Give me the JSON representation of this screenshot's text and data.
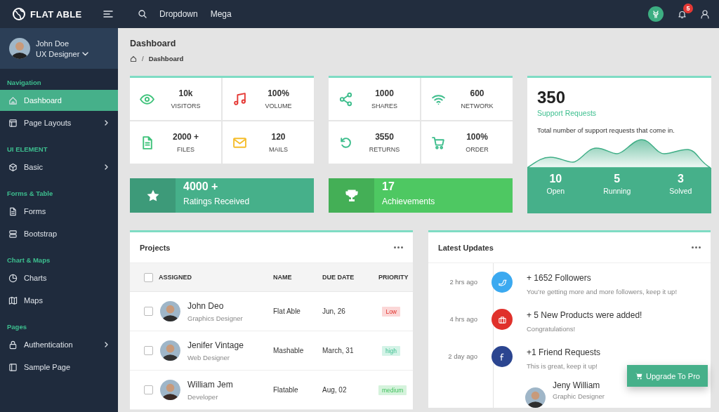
{
  "topbar": {
    "brand": "FLAT ABLE",
    "links": [
      "Dropdown",
      "Mega"
    ],
    "notification_count": "5"
  },
  "sidebar": {
    "user": {
      "name": "John Doe",
      "role": "UX Designer"
    },
    "sections": [
      {
        "title": "Navigation",
        "items": [
          {
            "label": "Dashboard",
            "selected": true,
            "expandable": false
          },
          {
            "label": "Page Layouts",
            "selected": false,
            "expandable": true
          }
        ]
      },
      {
        "title": "UI ELEMENT",
        "items": [
          {
            "label": "Basic",
            "selected": false,
            "expandable": true
          }
        ]
      },
      {
        "title": "Forms & Table",
        "items": [
          {
            "label": "Forms",
            "selected": false,
            "expandable": false
          },
          {
            "label": "Bootstrap",
            "selected": false,
            "expandable": false
          }
        ]
      },
      {
        "title": "Chart & Maps",
        "items": [
          {
            "label": "Charts",
            "selected": false,
            "expandable": false
          },
          {
            "label": "Maps",
            "selected": false,
            "expandable": false
          }
        ]
      },
      {
        "title": "Pages",
        "items": [
          {
            "label": "Authentication",
            "selected": false,
            "expandable": true
          },
          {
            "label": "Sample Page",
            "selected": false,
            "expandable": false
          }
        ]
      }
    ]
  },
  "page": {
    "title": "Dashboard",
    "breadcrumb_separator": "/",
    "breadcrumb": "Dashboard"
  },
  "stat_groups": [
    [
      {
        "value": "10k",
        "label": "VISITORS",
        "color": "#3ec27a"
      },
      {
        "value": "100%",
        "label": "VOLUME",
        "color": "#e53935"
      },
      {
        "value": "2000 +",
        "label": "FILES",
        "color": "#3ec27a"
      },
      {
        "value": "120",
        "label": "MAILS",
        "color": "#f5bd2b"
      }
    ],
    [
      {
        "value": "1000",
        "label": "SHARES",
        "color": "#3dbd8c"
      },
      {
        "value": "600",
        "label": "NETWORK",
        "color": "#3dbd8c"
      },
      {
        "value": "3550",
        "label": "RETURNS",
        "color": "#3dbd8c"
      },
      {
        "value": "100%",
        "label": "ORDER",
        "color": "#3dbd8c"
      }
    ]
  ],
  "banners": [
    {
      "value": "4000 +",
      "label": "Ratings Received",
      "color": "#46b08a"
    },
    {
      "value": "17",
      "label": "Achievements",
      "color": "#4ec862"
    }
  ],
  "support": {
    "value": "350",
    "label": "Support Requests",
    "description": "Total number of support requests that come in.",
    "stats": [
      {
        "value": "10",
        "label": "Open"
      },
      {
        "value": "5",
        "label": "Running"
      },
      {
        "value": "3",
        "label": "Solved"
      }
    ]
  },
  "projects": {
    "title": "Projects",
    "all_checked": false,
    "columns": [
      "ASSIGNED",
      "NAME",
      "DUE DATE",
      "PRIORITY"
    ],
    "rows": [
      {
        "checked": false,
        "name": "John Deo",
        "role": "Graphics Designer",
        "project": "Flat Able",
        "due": "Jun, 26",
        "priority": "Low",
        "kind": "low"
      },
      {
        "checked": false,
        "name": "Jenifer Vintage",
        "role": "Web Designer",
        "project": "Mashable",
        "due": "March, 31",
        "priority": "high",
        "kind": "high"
      },
      {
        "checked": false,
        "name": "William Jem",
        "role": "Developer",
        "project": "Flatable",
        "due": "Aug, 02",
        "priority": "medium",
        "kind": "medium"
      }
    ]
  },
  "updates": {
    "title": "Latest Updates",
    "items": [
      {
        "time": "2 hrs ago",
        "title": "+ 1652 Followers",
        "text": "You’re getting more and more followers, keep it up!",
        "color": "#3ba9f0"
      },
      {
        "time": "4 hrs ago",
        "title": "+ 5 New Products were added!",
        "text": "Congratulations!",
        "color": "#e0312b"
      },
      {
        "time": "2 day ago",
        "title": "+1 Friend Requests",
        "text": "This is great, keep it up!",
        "color": "#2b4590"
      }
    ],
    "person": {
      "name": "Jeny William",
      "role": "Graphic Designer"
    }
  },
  "upgrade_button": "Upgrade To Pro"
}
